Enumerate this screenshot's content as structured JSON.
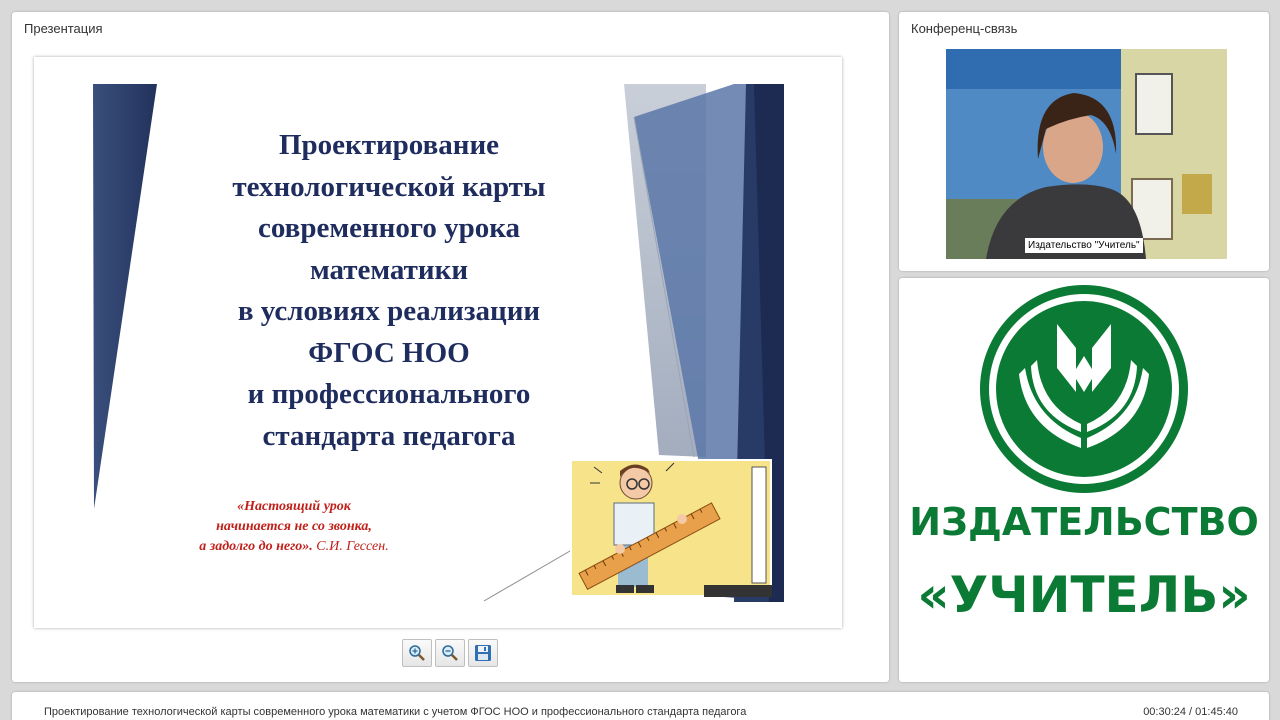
{
  "presentation": {
    "title": "Презентация",
    "slide": {
      "title_lines": [
        "Проектирование",
        "технологической карты",
        "современного урока",
        "математики",
        "в условиях реализации",
        "ФГОС НОО",
        "и профессионального",
        "стандарта педагога"
      ],
      "quote_lines": [
        "«Настоящий урок",
        "начинается не со звонка,",
        "а задолго до него»."
      ],
      "quote_author": "С.И. Гессен."
    },
    "toolbar": {
      "zoom_in_icon": "zoom-in-icon",
      "zoom_out_icon": "zoom-out-icon",
      "save_icon": "floppy-disk-icon"
    }
  },
  "conference": {
    "title": "Конференц-связь",
    "video_label": "Издательство \"Учитель\""
  },
  "logo": {
    "line1": "ИЗДАТЕЛЬСТВО",
    "line2": "«УЧИТЕЛЬ»",
    "color": "#0b7a35"
  },
  "bottom": {
    "caption": "Проектирование технологической карты современного урока математики с учетом ФГОС НОО и профессионального стандарта педагога",
    "time": "00:30:24 / 01:45:40"
  },
  "colors": {
    "slide_title": "#1f2c5e",
    "quote": "#c0201a",
    "slide_navy": "#2c3e6b"
  }
}
